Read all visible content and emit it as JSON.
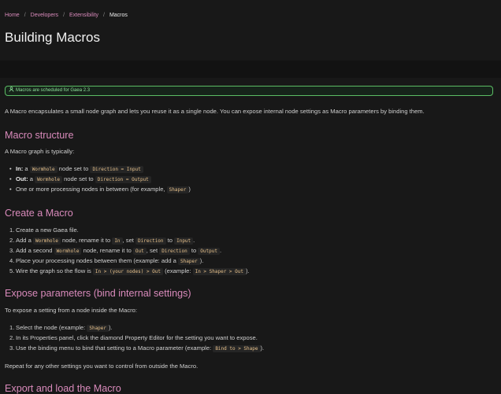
{
  "breadcrumb": {
    "items": [
      "Home",
      "Developers",
      "Extensibility"
    ],
    "current": "Macros"
  },
  "page_title": "Building Macros",
  "banner": {
    "text": "Macros are scheduled for Gaea 2.3",
    "icon": "version-icon",
    "color": "#5bbd64"
  },
  "intro": "A Macro encapsulates a small node graph and lets you reuse it as a single node. You can expose internal node settings as Macro parameters by binding them.",
  "sections": {
    "structure": {
      "heading": "Macro structure",
      "lead": "A Macro graph is typically:",
      "items": [
        {
          "label": "In:",
          "t1": " a ",
          "c1": "Wormhole",
          "t2": " node set to ",
          "c2": "Direction = Input"
        },
        {
          "label": "Out:",
          "t1": " a ",
          "c1": "Wormhole",
          "t2": " node set to ",
          "c2": "Direction = Output"
        },
        {
          "t1": "One or more processing nodes in between (for example, ",
          "c1": "Shaper",
          "t2": ")"
        }
      ]
    },
    "create": {
      "heading": "Create a Macro",
      "steps": [
        {
          "num": "1.",
          "t1": "Create a new Gaea file."
        },
        {
          "num": "2.",
          "t1": "Add a ",
          "c1": "Wormhole",
          "t2": " node, rename it to ",
          "c2": "In",
          "t3": ", set ",
          "c3": "Direction",
          "t4": " to ",
          "c4": "Input",
          "t5": "."
        },
        {
          "num": "3.",
          "t1": "Add a second ",
          "c1": "Wormhole",
          "t2": " node, rename it to ",
          "c2": "Out",
          "t3": ", set ",
          "c3": "Direction",
          "t4": " to ",
          "c4": "Output",
          "t5": "."
        },
        {
          "num": "4.",
          "t1": "Place your processing nodes between them (example: add a ",
          "c1": "Shaper",
          "t2": ")."
        },
        {
          "num": "5.",
          "t1": "Wire the graph so the flow is ",
          "c1": "In > (your nodes) > Out",
          "t2": " (example: ",
          "c2": "In > Shaper > Out",
          "t3": ")."
        }
      ]
    },
    "expose": {
      "heading": "Expose parameters (bind internal settings)",
      "lead": "To expose a setting from a node inside the Macro:",
      "steps": [
        {
          "num": "1.",
          "t1": "Select the node (example: ",
          "c1": "Shaper",
          "t2": ")."
        },
        {
          "num": "2.",
          "t1": "In its Properties panel, click the diamond Property Editor for the setting you want to expose."
        },
        {
          "num": "3.",
          "t1": "Use the binding menu to bind that setting to a Macro parameter (example: ",
          "c1": "Bind to > Shape",
          "t2": ")."
        }
      ],
      "outro": "Repeat for any other settings you want to control from outside the Macro."
    },
    "export": {
      "heading": "Export and load the Macro"
    }
  }
}
